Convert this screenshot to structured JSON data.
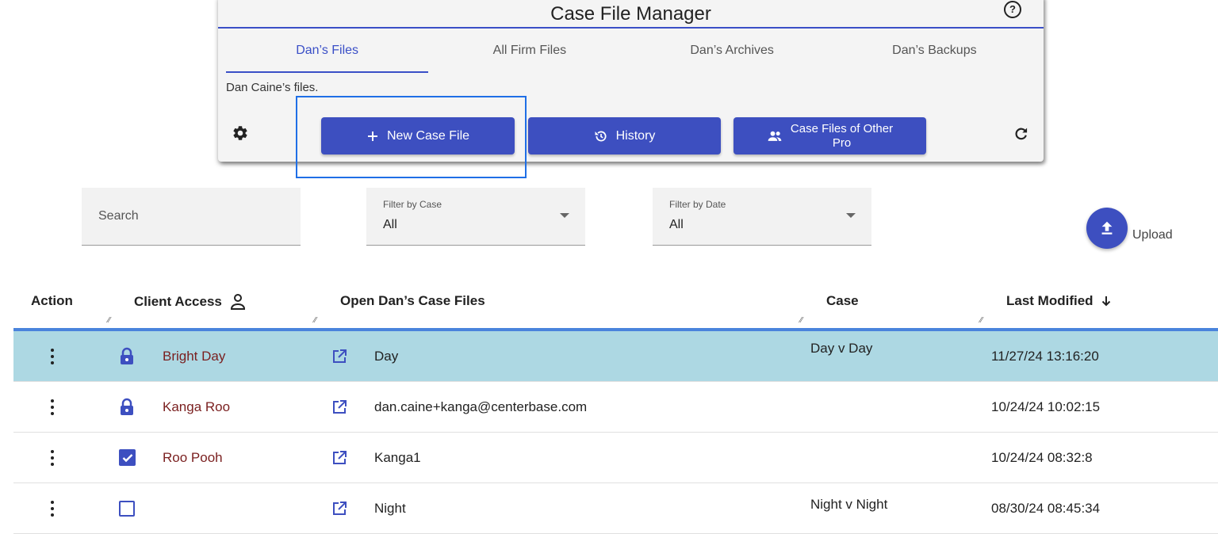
{
  "header": {
    "title": "Case File Manager",
    "help_icon": "help-circle-icon"
  },
  "tabs": [
    {
      "label": "Dan’s Files",
      "active": true
    },
    {
      "label": "All Firm Files",
      "active": false
    },
    {
      "label": "Dan’s Archives",
      "active": false
    },
    {
      "label": "Dan’s Backups",
      "active": false
    }
  ],
  "description": "Dan Caine’s files.",
  "toolbar": {
    "settings_icon": "gear-icon",
    "new_case_file_label": "New Case File",
    "history_label": "History",
    "other_pro_line1": "Case Files of Other",
    "other_pro_line2": "Pro",
    "refresh_icon": "refresh-icon"
  },
  "filters": {
    "search_placeholder": "Search",
    "case_label": "Filter by Case",
    "case_value": "All",
    "date_label": "Filter by Date",
    "date_value": "All"
  },
  "upload_label": "Upload",
  "colors": {
    "primary": "#3d4fc0",
    "selected_row": "#add8e3",
    "client_name": "#7a1f1f"
  },
  "table": {
    "headers": {
      "action": "Action",
      "client_access": "Client Access",
      "open": "Open Dan’s Case Files",
      "case": "Case",
      "last_modified": "Last Modified"
    },
    "rows": [
      {
        "client_access": "lock",
        "client": "Bright Day",
        "open": "Day",
        "case": "Day v Day",
        "modified": "11/27/24 13:16:20",
        "selected": true
      },
      {
        "client_access": "lock",
        "client": "Kanga Roo",
        "open": "dan.caine+kanga@centerbase.com",
        "case": "",
        "modified": "10/24/24 10:02:15",
        "selected": false
      },
      {
        "client_access": "checked",
        "client": "Roo Pooh",
        "open": "Kanga1",
        "case": "",
        "modified": "10/24/24 08:32:8",
        "selected": false
      },
      {
        "client_access": "unchecked",
        "client": "",
        "open": "Night",
        "case": "Night v Night",
        "modified": "08/30/24 08:45:34",
        "selected": false
      }
    ]
  }
}
